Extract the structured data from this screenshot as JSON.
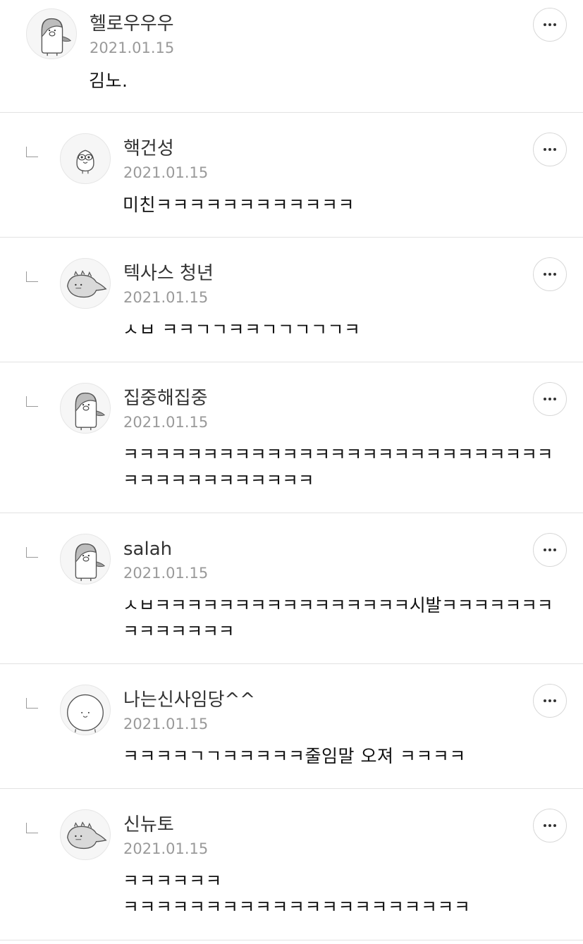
{
  "comments": [
    {
      "nickname": "헬로우우우",
      "date": "2021.01.15",
      "content": "김노.",
      "avatar": "penguin-avatar-icon",
      "is_reply": false
    },
    {
      "nickname": "핵건성",
      "date": "2021.01.15",
      "content": "미친ㅋㅋㅋㅋㅋㅋㅋㅋㅋㅋㅋㅋ",
      "avatar": "bird-avatar-icon",
      "is_reply": true
    },
    {
      "nickname": "텍사스 청년",
      "date": "2021.01.15",
      "content": "ㅅㅂ ㅋㅋㄱㄱㅋㅋㄱㄱㄱㄱㄱㅋ",
      "avatar": "dinosaur-avatar-icon",
      "is_reply": true
    },
    {
      "nickname": "집중해집중",
      "date": "2021.01.15",
      "content": "ㅋㅋㅋㅋㅋㅋㅋㅋㅋㅋㅋㅋㅋㅋㅋㅋㅋㅋㅋㅋㅋㅋㅋㅋㅋㅋㅋ\nㅋㅋㅋㅋㅋㅋㅋㅋㅋㅋㅋㅋ",
      "avatar": "penguin-avatar-icon",
      "is_reply": true
    },
    {
      "nickname": "salah",
      "date": "2021.01.15",
      "content": "ㅅㅂㅋㅋㅋㅋㅋㅋㅋㅋㅋㅋㅋㅋㅋㅋㅋㅋ시발ㅋㅋㅋㅋㅋㅋㅋ\nㅋㅋㅋㅋㅋㅋㅋ",
      "avatar": "penguin-avatar-icon",
      "is_reply": true
    },
    {
      "nickname": "나는신사임당^^",
      "date": "2021.01.15",
      "content": "ㅋㅋㅋㅋㄱㄱㅋㅋㅋㅋㅋ줄임말 오져 ㅋㅋㅋㅋ",
      "avatar": "round-face-avatar-icon",
      "is_reply": true
    },
    {
      "nickname": "신뉴토",
      "date": "2021.01.15",
      "content": "ㅋㅋㅋㅋㅋㅋ\nㅋㅋㅋㅋㅋㅋㅋㅋㅋㅋㅋㅋㅋㅋㅋㅋㅋㅋㅋㅋㅋ",
      "avatar": "dinosaur-avatar-icon",
      "is_reply": true
    }
  ]
}
